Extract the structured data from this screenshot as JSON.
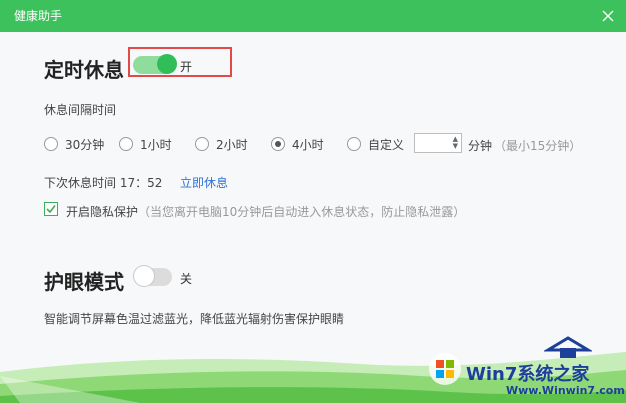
{
  "window": {
    "title": "健康助手"
  },
  "timed_rest": {
    "title": "定时休息",
    "toggle_state": "开",
    "interval_label": "休息间隔时间",
    "options": [
      {
        "label": "30分钟",
        "checked": false
      },
      {
        "label": "1小时",
        "checked": false
      },
      {
        "label": "2小时",
        "checked": false
      },
      {
        "label": "4小时",
        "checked": true
      },
      {
        "label": "自定义",
        "checked": false
      }
    ],
    "custom_unit": "分钟",
    "custom_hint": "（最小15分钟）",
    "next_rest_label": "下次休息时间 17：52",
    "rest_now_link": "立即休息",
    "privacy_label": "开启隐私保护",
    "privacy_hint": "（当您离开电脑10分钟后自动进入休息状态，防止隐私泄露）"
  },
  "eye_care": {
    "title": "护眼模式",
    "toggle_state": "关",
    "description": "智能调节屏幕色温过滤蓝光，降低蓝光辐射伤害保护眼睛"
  },
  "watermark": {
    "brand": "Win7系统之家",
    "url": "Www.Winwin7.com"
  },
  "colors": {
    "accent": "#3cc15d",
    "toggle_on": "#31bd58",
    "link": "#2f73d9",
    "highlight": "#e24a4a"
  }
}
